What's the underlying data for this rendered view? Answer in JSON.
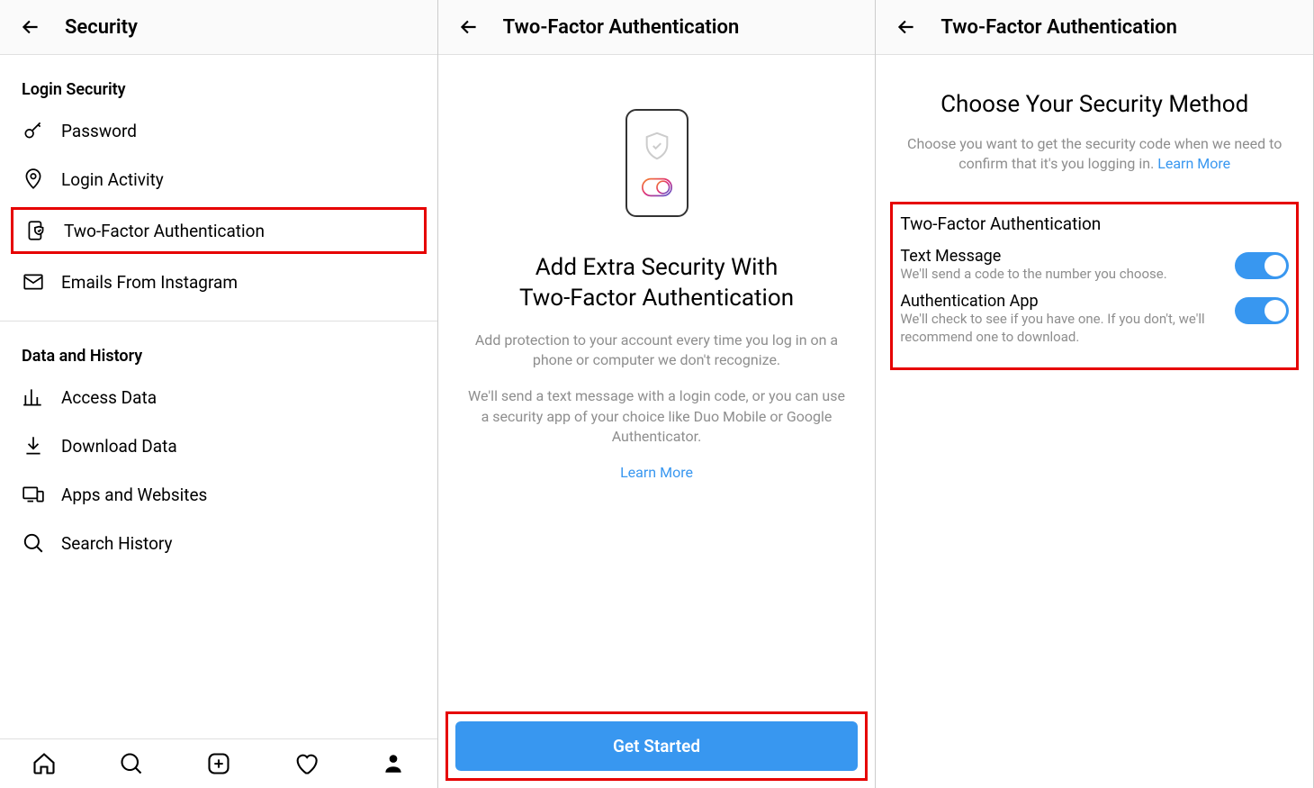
{
  "panel1": {
    "header_title": "Security",
    "sections": [
      {
        "label": "Login Security",
        "items": [
          {
            "icon": "key",
            "label": "Password"
          },
          {
            "icon": "pin",
            "label": "Login Activity"
          },
          {
            "icon": "phone-shield",
            "label": "Two-Factor Authentication",
            "highlighted": true
          },
          {
            "icon": "mail",
            "label": "Emails From Instagram"
          }
        ]
      },
      {
        "label": "Data and History",
        "items": [
          {
            "icon": "chart",
            "label": "Access Data"
          },
          {
            "icon": "download",
            "label": "Download Data"
          },
          {
            "icon": "devices",
            "label": "Apps and Websites"
          },
          {
            "icon": "search",
            "label": "Search History"
          }
        ]
      }
    ],
    "tabbar": [
      "home",
      "search",
      "add",
      "activity",
      "profile"
    ]
  },
  "panel2": {
    "header_title": "Two-Factor Authentication",
    "heading_line1": "Add Extra Security With",
    "heading_line2": "Two-Factor Authentication",
    "body1": "Add protection to your account every time you log in on a phone or computer we don't recognize.",
    "body2": "We'll send a text message with a login code, or you can use a security app of your choice like Duo Mobile or Google Authenticator.",
    "learn_more": "Learn More",
    "cta": "Get Started"
  },
  "panel3": {
    "header_title": "Two-Factor Authentication",
    "heading": "Choose Your Security Method",
    "subtext": "Choose you want to get the security code when we need to confirm that it's you logging in. ",
    "learn_more": "Learn More",
    "box_title": "Two-Factor Authentication",
    "options": [
      {
        "title": "Text Message",
        "desc": "We'll send a code to the number you choose.",
        "on": true
      },
      {
        "title": "Authentication App",
        "desc": "We'll check to see if you have one. If you don't, we'll recommend one to download.",
        "on": true
      }
    ]
  }
}
